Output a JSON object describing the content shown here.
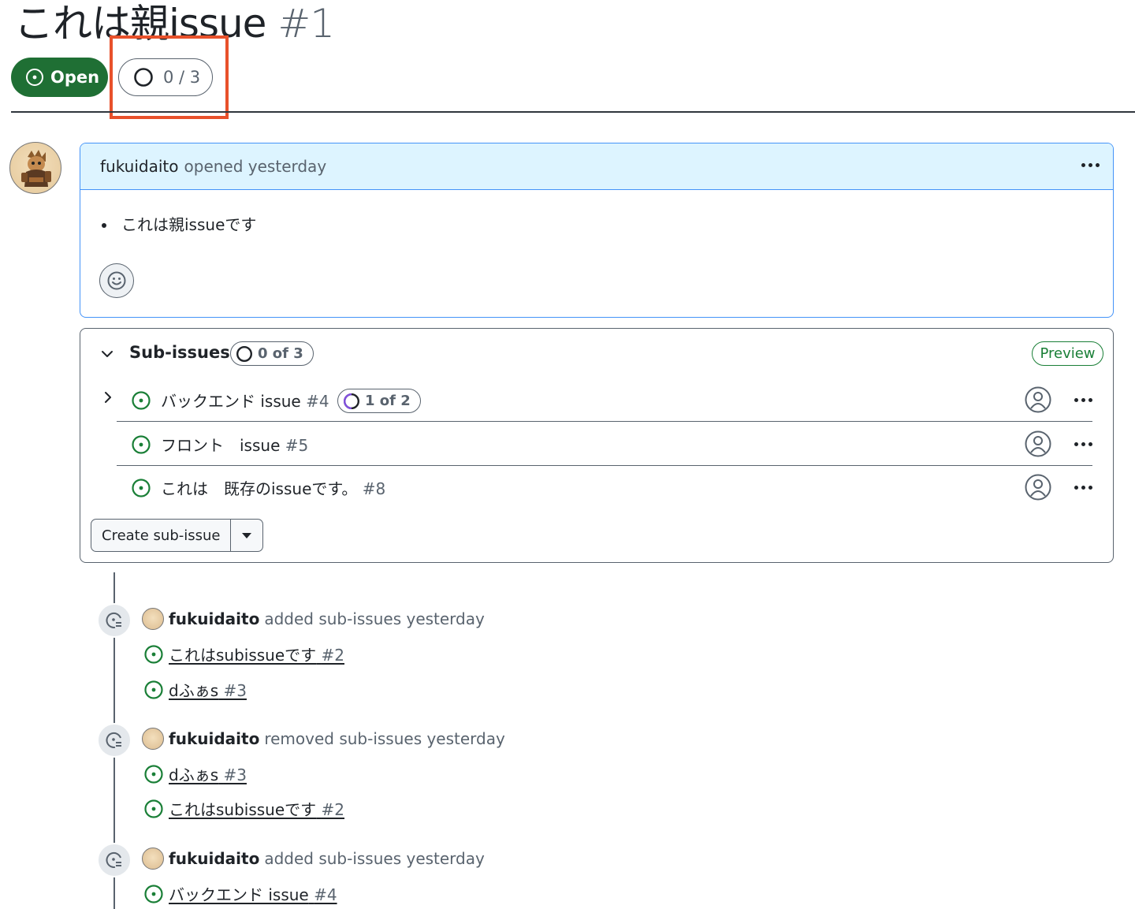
{
  "issue": {
    "title": "これは親issue",
    "number": "#1",
    "state": "Open",
    "progress": "0 / 3"
  },
  "comment": {
    "author": "fukuidaito",
    "action": "opened yesterday",
    "body_items": [
      "これは親issueです"
    ]
  },
  "sub_issues": {
    "title": "Sub-issues",
    "count": "0 of 3",
    "preview_label": "Preview",
    "items": [
      {
        "title": "バックエンド issue",
        "number": "#4",
        "progress": "1 of 2",
        "progress_fraction": 0.5,
        "expandable": true
      },
      {
        "title": "フロント　issue",
        "number": "#5"
      },
      {
        "title": "これは　既存のissueです。",
        "number": "#8"
      }
    ],
    "create_label": "Create sub-issue"
  },
  "timeline": [
    {
      "author": "fukuidaito",
      "action": "added sub-issues yesterday",
      "links": [
        {
          "title": "これはsubissueです",
          "number": "#2"
        },
        {
          "title": "dふぁs",
          "number": "#3"
        }
      ]
    },
    {
      "author": "fukuidaito",
      "action": "removed sub-issues yesterday",
      "links": [
        {
          "title": "dふぁs",
          "number": "#3"
        },
        {
          "title": "これはsubissueです",
          "number": "#2"
        }
      ]
    },
    {
      "author": "fukuidaito",
      "action": "added sub-issues yesterday",
      "links": [
        {
          "title": "バックエンド issue",
          "number": "#4"
        }
      ]
    }
  ],
  "colors": {
    "open_green": "#1f6f34",
    "open_icon": "#1a7f37",
    "highlight": "#e8512b",
    "comment_border": "#4493f8",
    "comment_header_bg": "#ddf4ff",
    "progress_purple": "#8250df"
  },
  "icons": {
    "state": "issue-opened-icon",
    "progress": "progress-circle-icon",
    "reaction": "smiley-icon",
    "collapse": "chevron-down-icon",
    "expand": "chevron-right-icon",
    "assignee": "person-circle-icon",
    "more": "kebab-horizontal-icon",
    "timeline": "sub-issue-icon"
  }
}
